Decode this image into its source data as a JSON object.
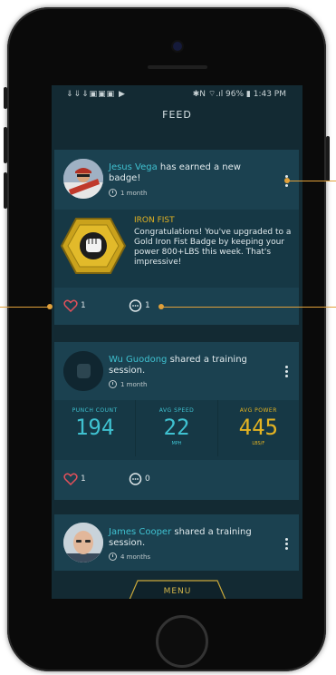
{
  "status_bar": {
    "left_icons": "⇓⇓⇓▣▣▣ ▶",
    "right_text": "✱N ⌔.ıl 96% ▮ 1:43 PM"
  },
  "header": {
    "title": "FEED"
  },
  "posts": [
    {
      "name": "Jesus Vega",
      "action": " has earned a new badge!",
      "time": "1 month",
      "badge_title": "IRON FIST",
      "badge_text": "Congratulations! You've upgraded to a Gold Iron Fist Badge by keeping your power 800+LBS this week. That's impressive!",
      "likes": "1",
      "comments": "1"
    },
    {
      "name": "Wu Guodong",
      "action": " shared a training session.",
      "time": "1 month",
      "stats": [
        {
          "label": "PUNCH COUNT",
          "value": "194",
          "unit": ""
        },
        {
          "label": "AVG SPEED",
          "value": "22",
          "unit": "MPH"
        },
        {
          "label": "AVG POWER",
          "value": "445",
          "unit": "LBS/F"
        }
      ],
      "likes": "1",
      "comments": "0"
    },
    {
      "name": "James Cooper",
      "action": " shared a training session.",
      "time": "4 months"
    }
  ],
  "menu": {
    "label": "MENU"
  },
  "colors": {
    "accent": "#3fc1d0",
    "gold": "#e3b322",
    "callout": "#e0a03a",
    "heart": "#e2505a"
  }
}
